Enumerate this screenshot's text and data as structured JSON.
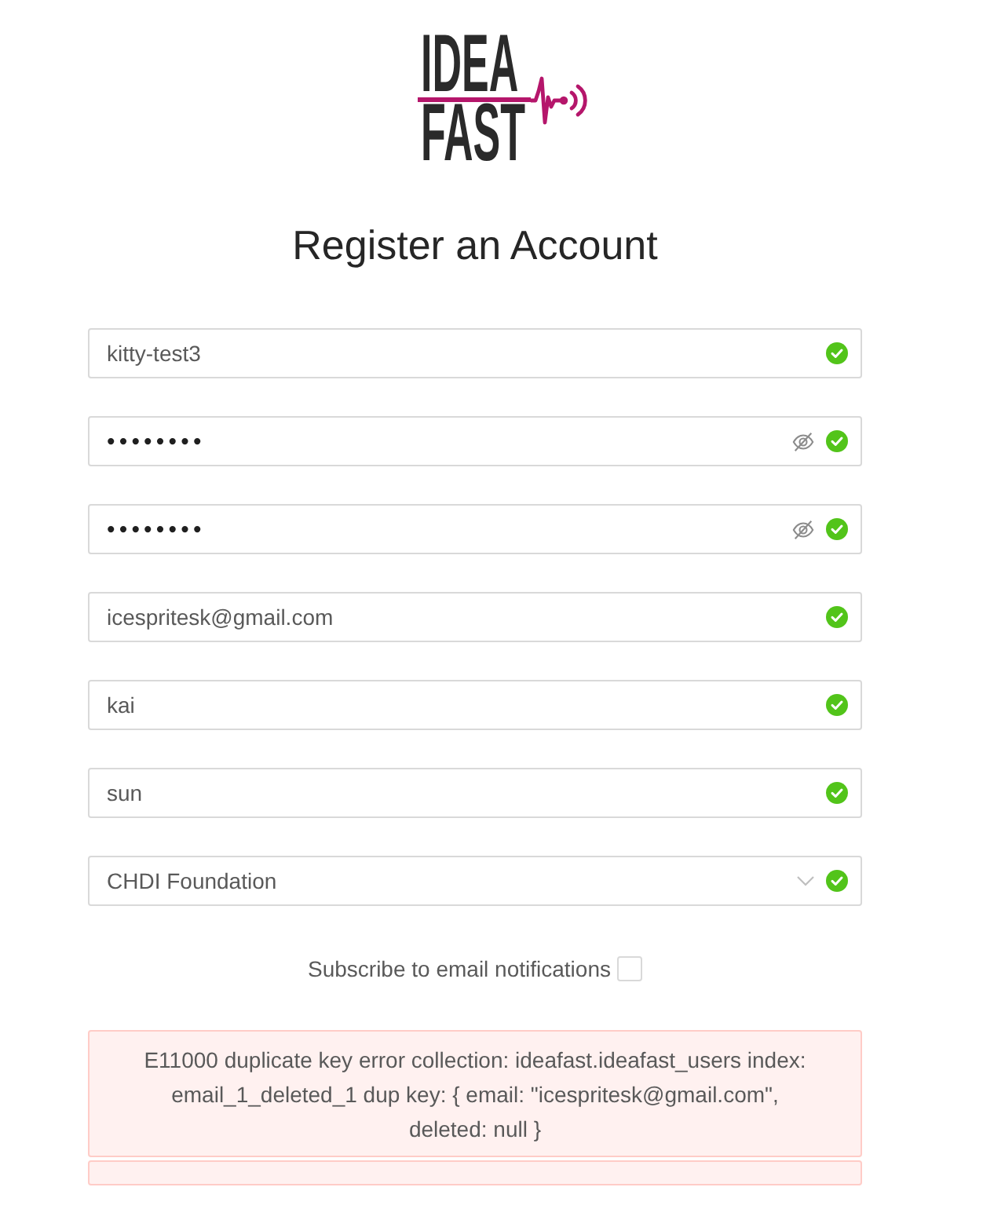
{
  "logo": {
    "line_1": "IDEA",
    "line_2": "FAST"
  },
  "title": "Register an Account",
  "fields": [
    {
      "kind": "text",
      "value": "kitty-test3",
      "valid": true
    },
    {
      "kind": "password",
      "value": "••••••••",
      "valid": true
    },
    {
      "kind": "password",
      "value": "••••••••",
      "valid": true
    },
    {
      "kind": "text",
      "value": "icespritesk@gmail.com",
      "valid": true
    },
    {
      "kind": "text",
      "value": "kai",
      "valid": true
    },
    {
      "kind": "text",
      "value": "sun",
      "valid": true
    },
    {
      "kind": "select",
      "value": "CHDI Foundation",
      "valid": true
    }
  ],
  "subscribe": {
    "label": "Subscribe to email notifications",
    "checked": false
  },
  "alerts": [
    {
      "kind": "message",
      "message": "E11000 duplicate key error collection: ideafast.ideafast_users index: email_1_deleted_1 dup key: { email: \"icespritesk@gmail.com\", deleted: null }"
    },
    {
      "kind": "empty"
    }
  ]
}
